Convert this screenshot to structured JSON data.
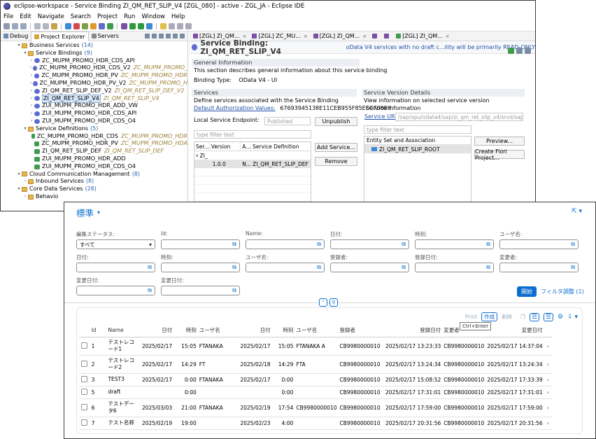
{
  "eclipse": {
    "title": "eclipse-workspace - Service Binding ZI_QM_RET_SLIP_V4 [ZGL_080] - active - ZGL_JA - Eclipse IDE",
    "menu": [
      "File",
      "Edit",
      "Navigate",
      "Search",
      "Project",
      "Run",
      "Window",
      "Help"
    ],
    "view_tabs": [
      "Debug",
      "Project Explorer",
      "Servers"
    ],
    "tree": [
      {
        "indent": 2,
        "twisty": "v",
        "icon": "folder",
        "label": "Business Services",
        "count": "(14)",
        "deco": ""
      },
      {
        "indent": 3,
        "twisty": "v",
        "icon": "folder",
        "label": "Service Bindings",
        "count": "(9)",
        "deco": ""
      },
      {
        "indent": 4,
        "twisty": ">",
        "icon": "svc",
        "label": "ZC_MUPM_PROMO_HDR_CDS_API",
        "count": "",
        "deco": ""
      },
      {
        "indent": 4,
        "twisty": ">",
        "icon": "svc",
        "label": "ZC_MUPM_PROMO_HDR_CDS_V2",
        "count": "",
        "deco": "ZC_MUPM_PROMO_"
      },
      {
        "indent": 4,
        "twisty": ">",
        "icon": "svc",
        "label": "ZC_MUPM_PROMO_HDR_PV",
        "count": "",
        "deco": "ZC_MUPM_PROMO_HDR"
      },
      {
        "indent": 4,
        "twisty": ">",
        "icon": "svc",
        "label": "ZC_MUPM_PROMO_HDR_PV_V2",
        "count": "",
        "deco": "ZC_MUPM_PROMO_H"
      },
      {
        "indent": 4,
        "twisty": ">",
        "icon": "svc",
        "label": "ZI_QM_RET_SLIP_DEF_V2",
        "count": "",
        "deco": "ZI_QM_RET_SLIP_DEF_V2"
      },
      {
        "indent": 4,
        "twisty": ">",
        "icon": "svc",
        "label": "ZI_QM_RET_SLIP_V4",
        "count": "",
        "deco": "ZI_QM_RET_SLIP_V4",
        "selected": true
      },
      {
        "indent": 4,
        "twisty": ">",
        "icon": "svc",
        "label": "ZUI_MUPM_PROMO_HDR_ADD_VW",
        "count": "",
        "deco": ""
      },
      {
        "indent": 4,
        "twisty": ">",
        "icon": "svc",
        "label": "ZUI_MUPM_PROMO_HDR_CDS_API",
        "count": "",
        "deco": ""
      },
      {
        "indent": 4,
        "twisty": ">",
        "icon": "svc",
        "label": "ZUI_MUPM_PROMO_HDR_CDS_O4",
        "count": "",
        "deco": ""
      },
      {
        "indent": 3,
        "twisty": "v",
        "icon": "folder",
        "label": "Service Definitions",
        "count": "(5)",
        "deco": ""
      },
      {
        "indent": 4,
        "twisty": "",
        "icon": "obj",
        "label": "ZC_MUPM_PROMO_HDR_CDS",
        "count": "",
        "deco": "ZC_MUPM_PROMO_HDR"
      },
      {
        "indent": 4,
        "twisty": "",
        "icon": "obj",
        "label": "ZC_MUPM_PROMO_HDR_PV",
        "count": "",
        "deco": "ZC_MUPM_PROMO_HDA"
      },
      {
        "indent": 4,
        "twisty": "",
        "icon": "obj",
        "label": "ZI_QM_RET_SLIP_DEF",
        "count": "",
        "deco": "ZI_QM_RET_SLIP_DEF"
      },
      {
        "indent": 4,
        "twisty": "",
        "icon": "obj",
        "label": "ZUI_MUPM_PROMO_HDR_ADD",
        "count": "",
        "deco": ""
      },
      {
        "indent": 4,
        "twisty": "",
        "icon": "obj",
        "label": "ZUI_MUPM_PROMO_HDR_CDS_O4",
        "count": "",
        "deco": ""
      },
      {
        "indent": 2,
        "twisty": "v",
        "icon": "folder",
        "label": "Cloud Communication Management",
        "count": "(8)",
        "deco": ""
      },
      {
        "indent": 3,
        "twisty": ">",
        "icon": "folder",
        "label": "Inbound Services",
        "count": "(8)",
        "deco": ""
      },
      {
        "indent": 2,
        "twisty": "v",
        "icon": "folder",
        "label": "Core Data Services",
        "count": "(28)",
        "deco": ""
      },
      {
        "indent": 3,
        "twisty": ">",
        "icon": "folder",
        "label": "Behavio",
        "count": "",
        "deco": ""
      }
    ],
    "editor_tabs": [
      "[ZGL] ZI_QM...",
      "[ZGL] ZC_MU...",
      "[ZGL] ZI_QM...",
      "",
      "",
      "[ZGL] ZI_QM..."
    ],
    "editor": {
      "title": "Service Binding: ZI_QM_RET_SLIP_V4",
      "warning": "oData V4 services with no draft c...ility will be primarily READ-ONLY",
      "general_info_header": "General Information",
      "general_info_text": "This section describes general information about this service binding",
      "binding_type_label": "Binding Type:",
      "binding_type_value": "OData V4 - UI",
      "services_header": "Services",
      "services_text": "Define services associated with the Service Binding",
      "auth_link": "Default Authorization Values:",
      "auth_value": "67693945138E11CEB955F85EEC7088H",
      "local_endpoint_label": "Local Service Endpoint:",
      "local_endpoint_value": "Published",
      "unpublish_btn": "Unpublish",
      "filter_placeholder": "type filter text",
      "grid_headers": [
        "Ser...",
        "Version",
        "A...",
        "Service Definition"
      ],
      "grid_group": "ZI_",
      "grid_row": [
        "",
        "1.0.0",
        "N...",
        "ZI_QM_RET_SLIP_DEF"
      ],
      "add_service_btn": "Add Service...",
      "remove_btn": "Remove",
      "version_header": "Service Version Details",
      "version_text": "View information on selected service version",
      "service_info_label": "Service Information",
      "service_url_label": "Service URL:",
      "service_url_value": "/sap/opu/odata4/sap/zi_qm_ret_slip_v4/srvd/sap/zi_q",
      "entity_filter_placeholder": "type filter text",
      "entity_header": "Entity Set and Association",
      "entity_item": "ZI_QM_RET_SLIP_ROOT",
      "preview_btn": "Preview...",
      "create_fiori_btn": "Create Fiori Project..."
    }
  },
  "fiori": {
    "variant": "標準",
    "filters": [
      {
        "label": "編集ステータス:",
        "value": "すべて",
        "kind": "select"
      },
      {
        "label": "Id:",
        "value": "",
        "kind": "vh"
      },
      {
        "label": "Name:",
        "value": "",
        "kind": "vh"
      },
      {
        "label": "日付:",
        "value": "",
        "kind": "vh"
      },
      {
        "label": "時刻:",
        "value": "",
        "kind": "vh"
      },
      {
        "label": "ユーザ名:",
        "value": "",
        "kind": "vh"
      },
      {
        "label": "日付:",
        "value": "",
        "kind": "vh"
      },
      {
        "label": "時刻:",
        "value": "",
        "kind": "vh"
      },
      {
        "label": "ユーザ名:",
        "value": "",
        "kind": "vh"
      },
      {
        "label": "登録者:",
        "value": "",
        "kind": "vh"
      },
      {
        "label": "登録日付:",
        "value": "",
        "kind": "vh"
      },
      {
        "label": "変更者:",
        "value": "",
        "kind": "vh"
      },
      {
        "label": "変更日付:",
        "value": "",
        "kind": "vh"
      },
      {
        "label": "変更日付:",
        "value": "",
        "kind": "vh"
      }
    ],
    "go_btn": "開始",
    "adapt_filters": "フィルタ調整 (1)",
    "toolbar": {
      "print": "Print",
      "create": "作成",
      "delete": "削除",
      "tooltip": "Ctrl+Enter"
    },
    "columns": [
      "Id",
      "Name",
      "日付",
      "時刻",
      "ユーザ名",
      "日付",
      "時刻",
      "ユーザ名",
      "登録者",
      "登録日付",
      "変更者",
      "変更日付"
    ],
    "rows": [
      [
        "1",
        "テストレコード1",
        "2025/02/17",
        "15:05",
        "FTANAKA",
        "2025/02/17",
        "15:05",
        "FTANAKA A",
        "CB9980000010",
        "2025/02/17 13:23:33",
        "CB9980000010",
        "2025/02/17 14:37:04"
      ],
      [
        "2",
        "テストレコード2",
        "2025/02/17",
        "14:29",
        "FT",
        "2025/02/18",
        "14:29",
        "FTA",
        "CB9980000010",
        "2025/02/17 13:24:34",
        "CB9980000010",
        "2025/02/17 13:24:34"
      ],
      [
        "3",
        "TEST3",
        "2025/02/17",
        "0:00",
        "FTANAKA",
        "2025/02/17",
        "0:00",
        "",
        "CB9980000010",
        "2025/02/17 15:08:52",
        "CB9980000010",
        "2025/02/17 17:33:39"
      ],
      [
        "5",
        "draft",
        "",
        "0:00",
        "",
        "",
        "0:00",
        "",
        "CB9980000010",
        "2025/02/17 17:31:01",
        "CB9980000010",
        "2025/02/17 17:31:01"
      ],
      [
        "6",
        "テストデータ6",
        "2025/03/03",
        "21:00",
        "FTANAKA",
        "2025/02/19",
        "17:54",
        "CB9980000010",
        "CB9980000010",
        "2025/02/17 17:59:00",
        "CB9980000010",
        "2025/02/17 17:59:00"
      ],
      [
        "7",
        "テスト名称",
        "2025/02/19",
        "19:00",
        "",
        "2025/02/23",
        "4:00",
        "",
        "CB9980000010",
        "2025/02/17 20:31:56",
        "CB9980000010",
        "2025/02/17 20:31:56"
      ]
    ]
  }
}
